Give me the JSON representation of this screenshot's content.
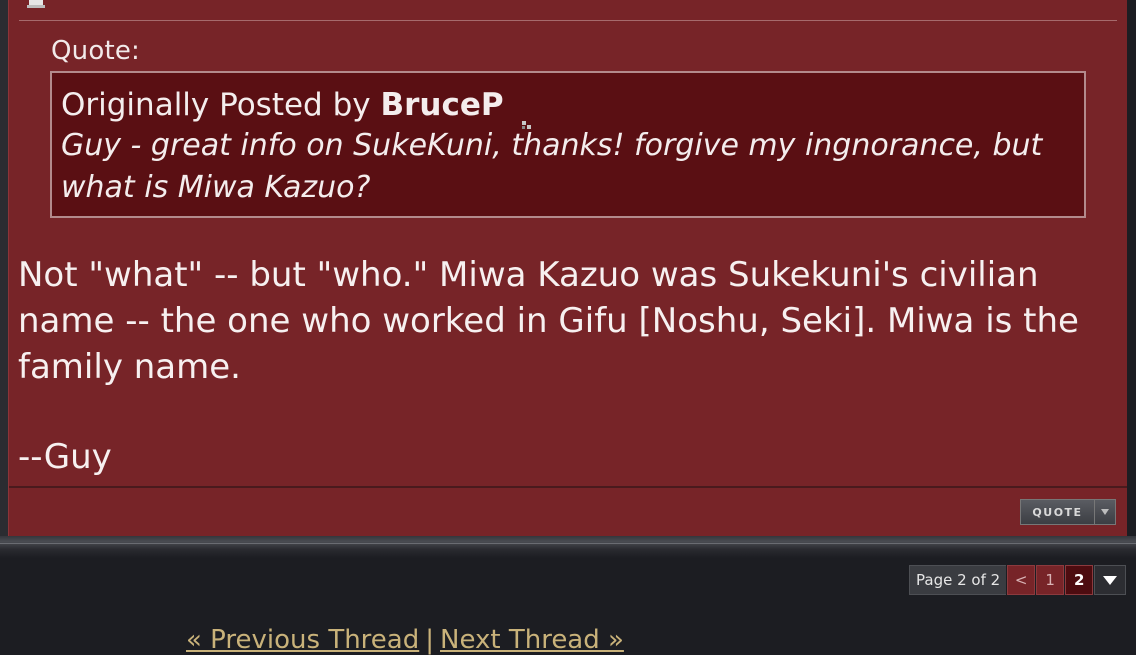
{
  "quote": {
    "label": "Quote:",
    "header_prefix": "Originally Posted by",
    "author": "BruceP",
    "body": "Guy - great info on SukeKuni, thanks! forgive my ingnorance, but what is Miwa Kazuo?"
  },
  "post": {
    "message": "Not \"what\" -- but \"who.\" Miwa Kazuo was Sukekuni's civilian name -- the one who worked in Gifu [Noshu, Seki]. Miwa is the family name.",
    "signature": "--Guy"
  },
  "quote_button": {
    "label": "QUOTE"
  },
  "pagination": {
    "info": "Page 2 of 2",
    "prev": "<",
    "pages": [
      "1",
      "2"
    ],
    "current": "2"
  },
  "thread_nav": {
    "previous": "« Previous Thread",
    "separator": "|",
    "next": "Next Thread »"
  },
  "colors": {
    "post_background": "#772428",
    "quote_background": "#5a0f13",
    "page_background": "#1c1d22",
    "link_color": "#c9b27a"
  },
  "icons": {
    "corner": "post-icon",
    "view_post": "view-post-icon",
    "quote_menu": "chevron-down-icon",
    "page_menu": "triangle-down-icon"
  }
}
